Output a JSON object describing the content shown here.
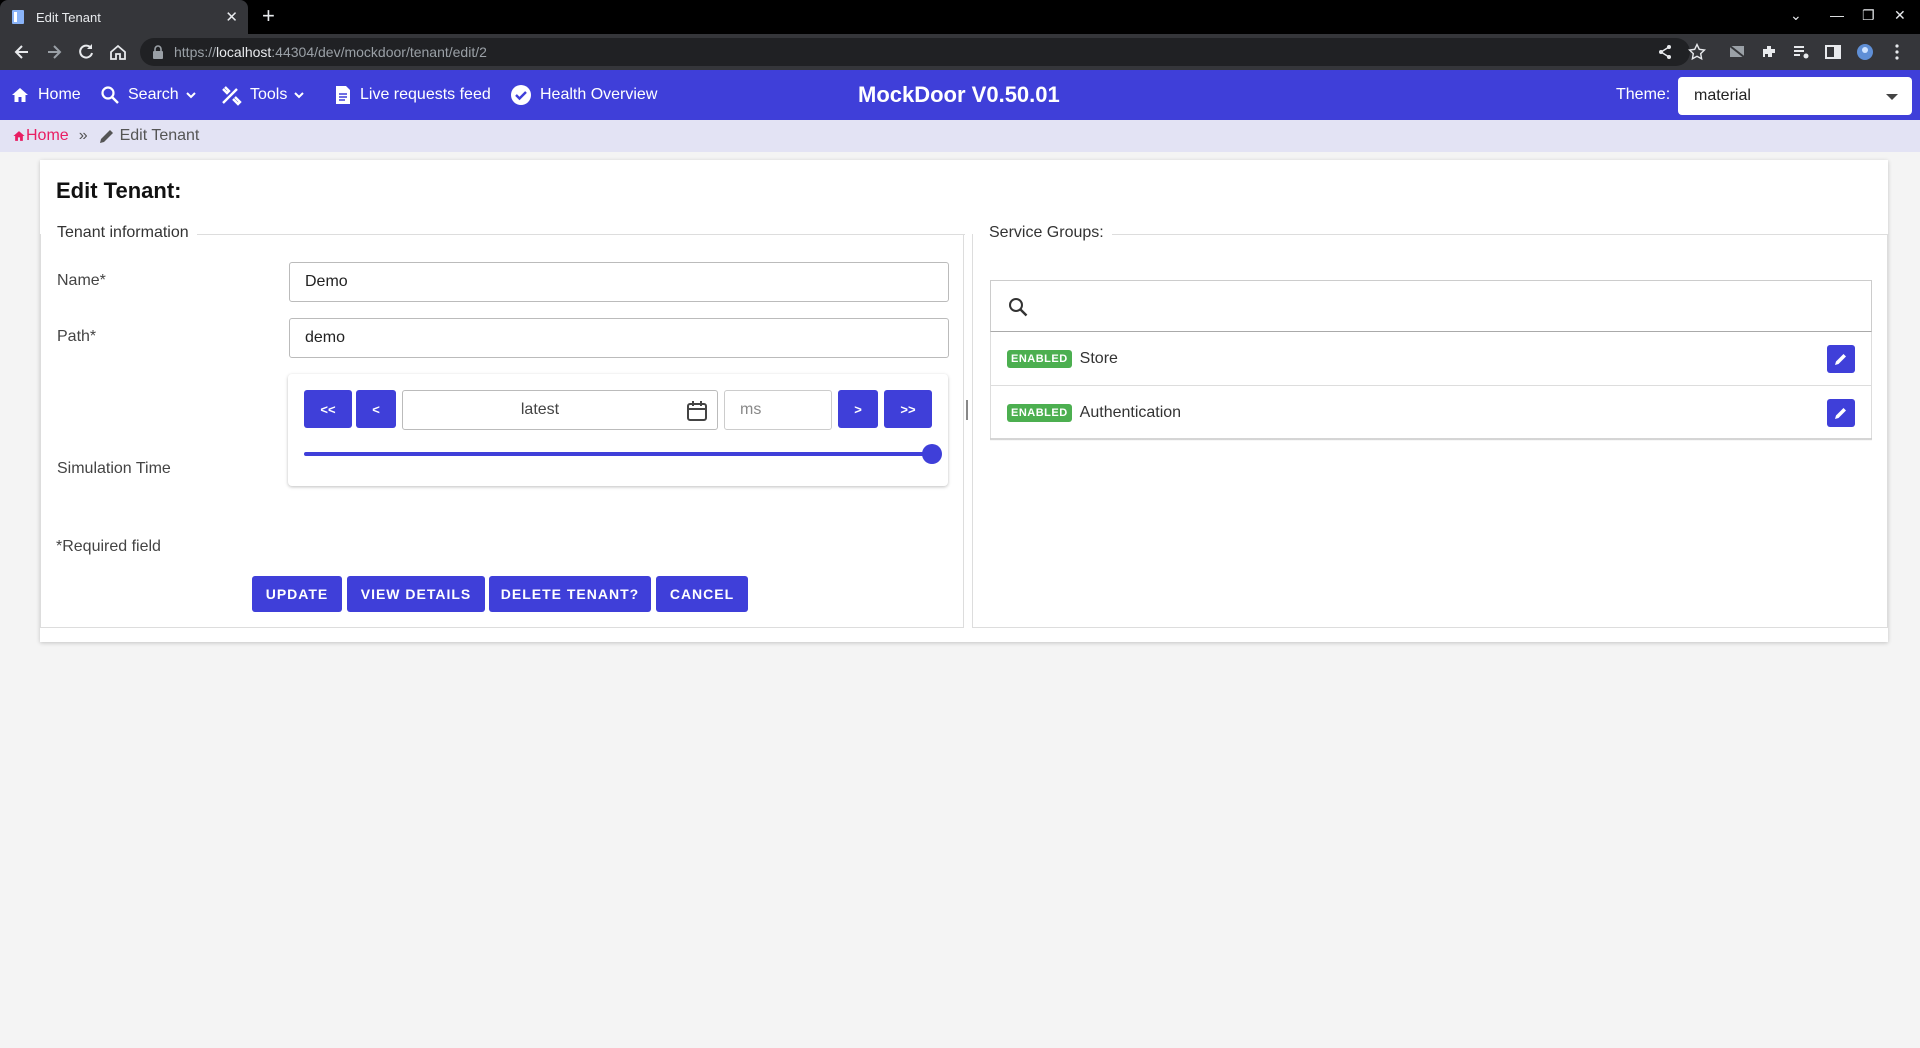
{
  "browser": {
    "tab_title": "Edit Tenant",
    "url_scheme": "https://",
    "url_host": "localhost",
    "url_rest": ":44304/dev/mockdoor/tenant/edit/2"
  },
  "header": {
    "nav": [
      {
        "label": "Home",
        "icon": "home-icon"
      },
      {
        "label": "Search",
        "icon": "search-icon"
      },
      {
        "label": "Tools",
        "icon": "tools-icon"
      },
      {
        "label": "Live requests feed",
        "icon": "document-icon"
      },
      {
        "label": "Health Overview",
        "icon": "check-circle-icon"
      }
    ],
    "title": "MockDoor V0.50.01",
    "theme_label": "Theme:",
    "theme_value": "material",
    "accent_color": "#3f3fd9"
  },
  "breadcrumb": {
    "home": "Home",
    "separator": "»",
    "current": "Edit Tenant"
  },
  "form": {
    "title": "Edit Tenant:",
    "section_title": "Tenant information",
    "name_label": "Name*",
    "name_value": "Demo",
    "path_label": "Path*",
    "path_value": "demo",
    "sim_label": "Simulation Time",
    "sim_buttons": {
      "first": "<<",
      "prev": "<",
      "next": ">",
      "last": ">>"
    },
    "sim_date_value": "latest",
    "sim_ms_placeholder": "ms",
    "slider_fraction": 1.0,
    "required_note": "*Required field",
    "actions": {
      "update": "UPDATE",
      "view_details": "VIEW DETAILS",
      "delete": "DELETE TENANT?",
      "cancel": "CANCEL"
    }
  },
  "service_groups": {
    "title": "Service Groups:",
    "search_placeholder": "",
    "items": [
      {
        "status": "ENABLED",
        "name": "Store"
      },
      {
        "status": "ENABLED",
        "name": "Authentication"
      }
    ],
    "status_color": "#4caf50"
  }
}
